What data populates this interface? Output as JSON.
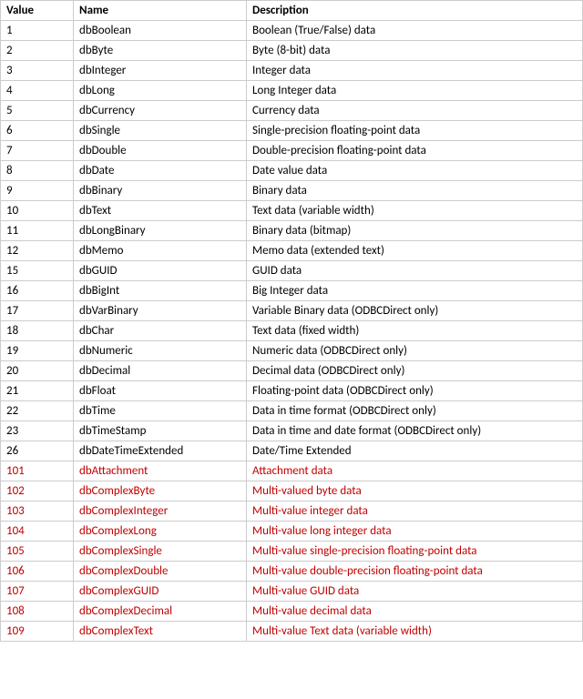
{
  "chart_data": {
    "type": "table",
    "columns": [
      "Value",
      "Name",
      "Description"
    ],
    "rows": [
      {
        "value": "1",
        "name": "dbBoolean",
        "description": "Boolean (True/False) data",
        "highlight": false
      },
      {
        "value": "2",
        "name": "dbByte",
        "description": "Byte (8-bit) data",
        "highlight": false
      },
      {
        "value": "3",
        "name": "dbInteger",
        "description": "Integer data",
        "highlight": false
      },
      {
        "value": "4",
        "name": "dbLong",
        "description": "Long Integer data",
        "highlight": false
      },
      {
        "value": "5",
        "name": "dbCurrency",
        "description": "Currency data",
        "highlight": false
      },
      {
        "value": "6",
        "name": "dbSingle",
        "description": "Single-precision floating-point data",
        "highlight": false
      },
      {
        "value": "7",
        "name": "dbDouble",
        "description": "Double-precision floating-point data",
        "highlight": false
      },
      {
        "value": "8",
        "name": "dbDate",
        "description": "Date value data",
        "highlight": false
      },
      {
        "value": "9",
        "name": "dbBinary",
        "description": "Binary data",
        "highlight": false
      },
      {
        "value": "10",
        "name": "dbText",
        "description": "Text data (variable width)",
        "highlight": false
      },
      {
        "value": "11",
        "name": "dbLongBinary",
        "description": "Binary data (bitmap)",
        "highlight": false
      },
      {
        "value": "12",
        "name": "dbMemo",
        "description": "Memo data (extended text)",
        "highlight": false
      },
      {
        "value": "15",
        "name": "dbGUID",
        "description": "GUID data",
        "highlight": false
      },
      {
        "value": "16",
        "name": "dbBigInt",
        "description": "Big Integer data",
        "highlight": false
      },
      {
        "value": "17",
        "name": "dbVarBinary",
        "description": "Variable Binary data (ODBCDirect only)",
        "highlight": false
      },
      {
        "value": "18",
        "name": "dbChar",
        "description": "Text data (fixed width)",
        "highlight": false
      },
      {
        "value": "19",
        "name": "dbNumeric",
        "description": "Numeric data (ODBCDirect only)",
        "highlight": false
      },
      {
        "value": "20",
        "name": "dbDecimal",
        "description": "Decimal data (ODBCDirect only)",
        "highlight": false
      },
      {
        "value": "21",
        "name": "dbFloat",
        "description": "Floating-point data (ODBCDirect only)",
        "highlight": false
      },
      {
        "value": "22",
        "name": "dbTime",
        "description": "Data in time format (ODBCDirect only)",
        "highlight": false
      },
      {
        "value": "23",
        "name": "dbTimeStamp",
        "description": "Data in time and date format (ODBCDirect only)",
        "highlight": false
      },
      {
        "value": "26",
        "name": "dbDateTimeExtended",
        "description": "Date/Time Extended",
        "highlight": false
      },
      {
        "value": "101",
        "name": "dbAttachment",
        "description": "Attachment data",
        "highlight": true
      },
      {
        "value": "102",
        "name": "dbComplexByte",
        "description": "Multi-valued byte data",
        "highlight": true
      },
      {
        "value": "103",
        "name": "dbComplexInteger",
        "description": "Multi-value integer data",
        "highlight": true
      },
      {
        "value": "104",
        "name": "dbComplexLong",
        "description": "Multi-value long integer data",
        "highlight": true
      },
      {
        "value": "105",
        "name": "dbComplexSingle",
        "description": "Multi-value single-precision floating-point data",
        "highlight": true
      },
      {
        "value": "106",
        "name": "dbComplexDouble",
        "description": "Multi-value double-precision floating-point data",
        "highlight": true
      },
      {
        "value": "107",
        "name": "dbComplexGUID",
        "description": "Multi-value GUID data",
        "highlight": true
      },
      {
        "value": "108",
        "name": "dbComplexDecimal",
        "description": "Multi-value decimal data",
        "highlight": true
      },
      {
        "value": "109",
        "name": "dbComplexText",
        "description": "Multi-value Text data (variable width)",
        "highlight": true
      }
    ]
  }
}
